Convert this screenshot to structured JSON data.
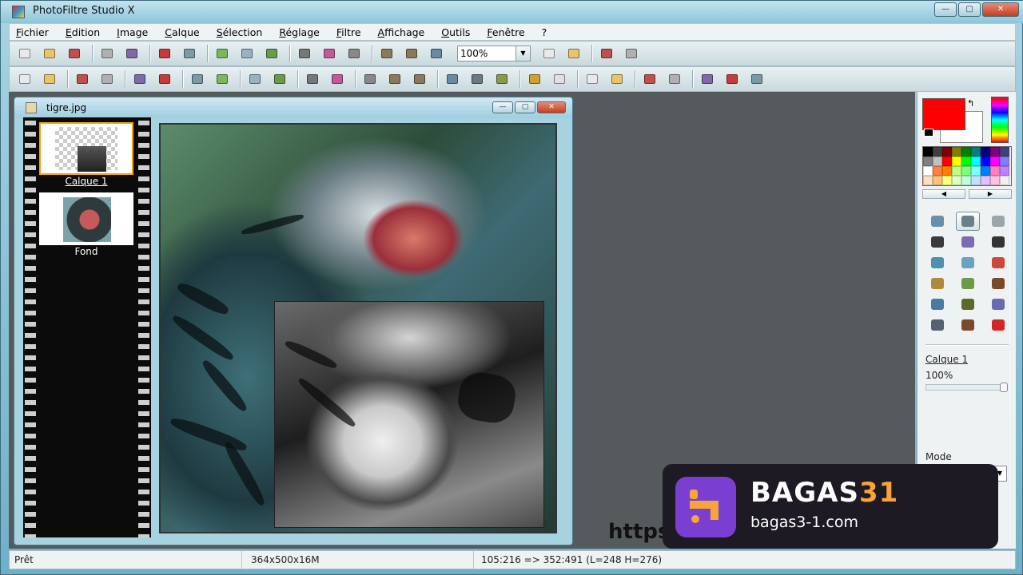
{
  "window": {
    "title": "PhotoFiltre Studio X"
  },
  "window_controls": {
    "minimize": "—",
    "maximize": "▢",
    "close": "✕"
  },
  "menu": [
    "Fichier",
    "Edition",
    "Image",
    "Calque",
    "Sélection",
    "Réglage",
    "Filtre",
    "Affichage",
    "Outils",
    "Fenêtre",
    "?"
  ],
  "toolbar": {
    "zoom_value": "100%",
    "tools_row1": [
      "new-file-icon",
      "open-file-icon",
      "save-icon",
      "print-icon",
      "scan-icon",
      "undo-icon",
      "redo-icon",
      "copy-icon",
      "paste-icon",
      "paste-as-image-icon",
      "crop-icon",
      "color-icon",
      "resize-icon",
      "image-size-icon",
      "canvas-size-icon",
      "fit-icon",
      "text-icon",
      "transform-icon",
      "effects-icon",
      "frame-icon"
    ],
    "tools_row2": [
      "auto-levels-icon",
      "auto-contrast-icon",
      "brightness-down-icon",
      "brightness-up-icon",
      "contrast-down-icon",
      "contrast-up-icon",
      "saturation-down-icon",
      "saturation-up-icon",
      "gamma-down-icon",
      "gamma-up-icon",
      "color-balance-icon",
      "histogram-icon",
      "grayscale-icon",
      "sepia-icon",
      "negative-icon",
      "emboss-icon",
      "blur-icon",
      "sharpen-icon",
      "soften-icon",
      "noise-icon",
      "rainbow-icon",
      "color-adjust-icon",
      "transform-icon",
      "flip-h-icon",
      "flip-v-icon",
      "rotate-left-icon",
      "rotate-right-icon"
    ]
  },
  "document": {
    "title": "tigre.jpg",
    "controls": {
      "minimize": "—",
      "maximize": "▢",
      "close": "✕"
    },
    "layers": [
      {
        "label": "Calque 1",
        "selected": true
      },
      {
        "label": "Fond",
        "selected": false
      }
    ]
  },
  "right_panel": {
    "foreground_color": "#ff0000",
    "background_color": "#ffffff",
    "swap_label": "↰",
    "palette_colors": [
      "#000000",
      "#404040",
      "#800000",
      "#808000",
      "#008000",
      "#008080",
      "#000080",
      "#800080",
      "#404080",
      "#808080",
      "#c0c0c0",
      "#ff0000",
      "#ffff00",
      "#00ff00",
      "#00ffff",
      "#0000ff",
      "#ff00ff",
      "#8080ff",
      "#ffffff",
      "#ff8040",
      "#ff8000",
      "#c0ff80",
      "#80ff80",
      "#80ffff",
      "#0080ff",
      "#ff80c0",
      "#c080ff",
      "#ffe0c0",
      "#ffc080",
      "#ffff80",
      "#e0ffc0",
      "#c0ffe0",
      "#c0e0ff",
      "#e0c0ff",
      "#ffc0e0",
      "#f0f0f0"
    ],
    "palette_arrows": {
      "left": "◀",
      "right": "▶"
    },
    "tools": [
      {
        "icon": "select-arrow-icon",
        "active": false,
        "color": "#6a8fa8"
      },
      {
        "icon": "rectangle-select-icon",
        "active": true,
        "color": "#6a7f88"
      },
      {
        "icon": "lasso-icon",
        "active": false,
        "color": "#9aa6ab"
      },
      {
        "icon": "eyedropper-icon",
        "active": false,
        "color": "#3a3a3a"
      },
      {
        "icon": "magic-wand-icon",
        "active": false,
        "color": "#7b6bb5"
      },
      {
        "icon": "line-icon",
        "active": false,
        "color": "#333333"
      },
      {
        "icon": "fill-bucket-icon",
        "active": false,
        "color": "#4f8fb0"
      },
      {
        "icon": "spray-icon",
        "active": false,
        "color": "#6aa3c0"
      },
      {
        "icon": "eraser-icon",
        "active": false,
        "color": "#d0463c"
      },
      {
        "icon": "brush-icon",
        "active": false,
        "color": "#b08a3a"
      },
      {
        "icon": "pencil-icon",
        "active": false,
        "color": "#6a9a4a"
      },
      {
        "icon": "stamp-icon",
        "active": false,
        "color": "#7a4a2a"
      },
      {
        "icon": "drop-blur-icon",
        "active": false,
        "color": "#4a7aa0"
      },
      {
        "icon": "smudge-icon",
        "active": false,
        "color": "#5a6a2a"
      },
      {
        "icon": "gradient-icon",
        "active": false,
        "color": "#6a6ab0"
      },
      {
        "icon": "pattern-icon",
        "active": false,
        "color": "#556070"
      },
      {
        "icon": "photo-icon",
        "active": false,
        "color": "#7a4a2a"
      },
      {
        "icon": "strawberry-icon",
        "active": false,
        "color": "#d02828"
      }
    ],
    "layer_name": "Calque 1",
    "opacity_value": "100%",
    "opacity_level": 1.0,
    "mode_label": "Mode",
    "mode_arrow": "▼"
  },
  "statusbar": {
    "status": "Prêt",
    "image_info": "364x500x16M",
    "selection_info": "105:216 => 352:491 (L=248  H=276)"
  },
  "watermark": {
    "brand_main": "BAGAS",
    "brand_accent": "31",
    "url": "bagas3-1.com",
    "behind_text": "https"
  }
}
